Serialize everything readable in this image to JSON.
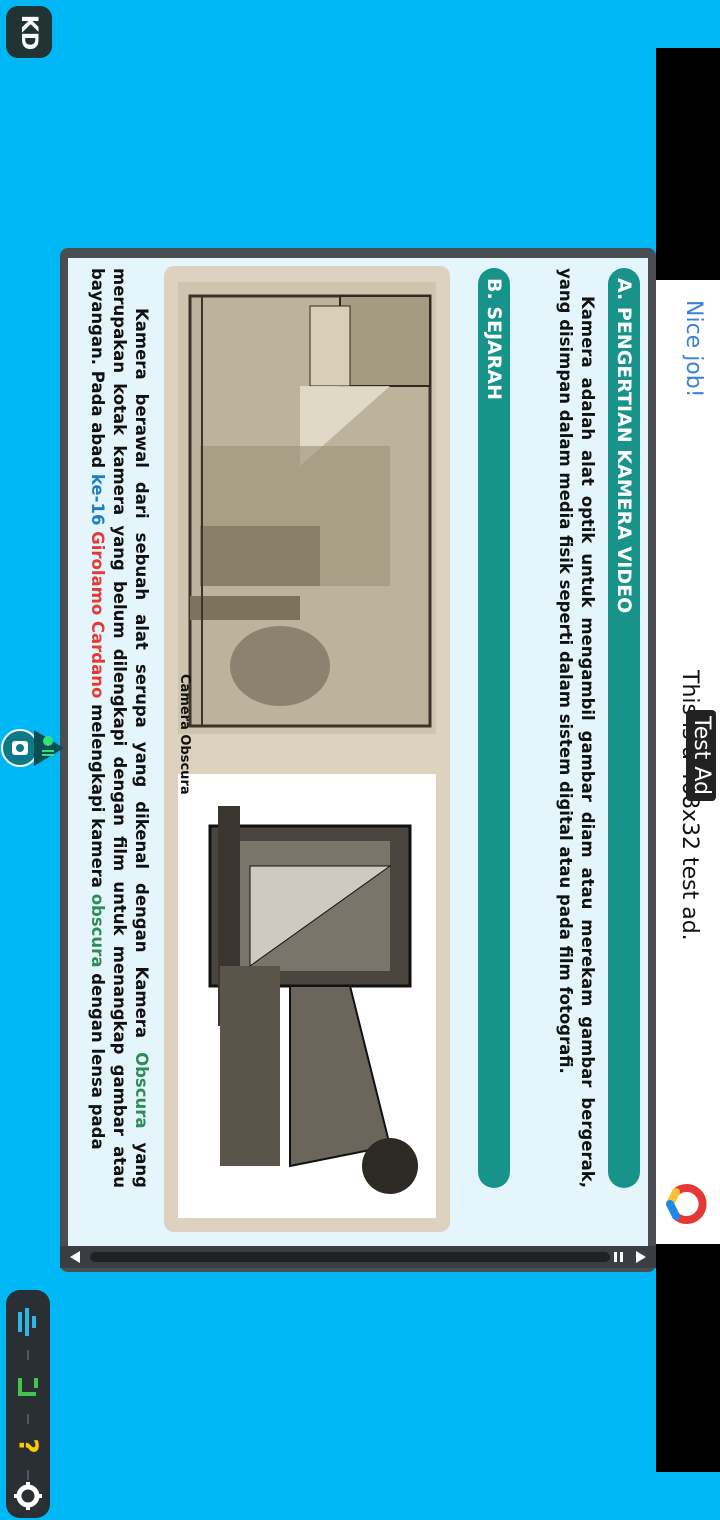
{
  "app": {
    "badge": "KD"
  },
  "ad": {
    "nice_job": "Nice job!",
    "text": "This is a 468x32 test ad.",
    "label": "Test Ad"
  },
  "content": {
    "section_a_title": "A. PENGERTIAN KAMERA VIDEO",
    "section_a_text": "Kamera adalah alat optik untuk mengambil gambar diam atau merekam gambar bergerak, yang disimpan dalam media fisik seperti dalam sistem digital atau pada film fotografi.",
    "section_b_title": "B. SEJARAH",
    "image_caption": "Camera Obscura",
    "section_b_text_1": "Kamera berawal dari sebuah alat serupa yang dikenal dengan Kamera ",
    "obscura_1": "Obscura",
    "section_b_text_2": " yang merupakan kotak kamera yang belum dilengkapi dengan film untuk menangkap gambar atau bayangan. Pada abad ",
    "century": "ke-16",
    "inventor": "Girolamo Cardano",
    "section_b_text_3": " melengkapi kamera ",
    "obscura_2": "obscura",
    "section_b_text_4": " dengan lensa pada"
  },
  "toolbar": {
    "icons": [
      "volume-icon",
      "undo-icon",
      "help-icon",
      "settings-icon"
    ],
    "help_label": "?"
  },
  "colors": {
    "background": "#00b7f6",
    "header": "#17938a",
    "panel": "#e4f6fc"
  }
}
